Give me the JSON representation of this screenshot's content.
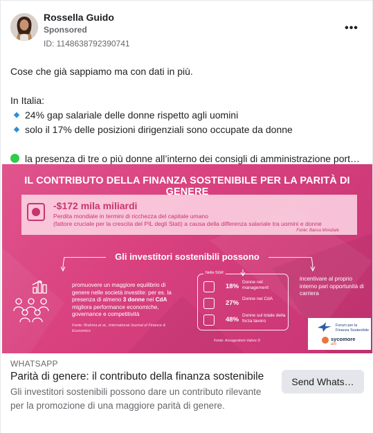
{
  "post": {
    "advertiser_name": "Rossella Guido",
    "sponsored_label": "Sponsored",
    "ad_id": "ID: 1148638792390741",
    "more_icon": "more-horizontal-icon",
    "more_glyph": "•••"
  },
  "body": {
    "intro": "Cose che già sappiamo ma con dati in più.",
    "country_heading": "In Italia:",
    "bullets": [
      "24% gap salariale delle donne rispetto agli uomini",
      "solo il 17% delle posizioni dirigenziali sono occupate da donne"
    ],
    "truncated_line": "la presenza di tre o più donne all’interno dei consigli di amministrazione porta…"
  },
  "banner": {
    "title": "IL CONTRIBUTO DELLA FINANZA SOSTENIBILE PER LA PARITÀ DI GENERE",
    "stat_value": "-$172 mila miliardi",
    "stat_desc_1": "Perdita mondiale in termini di ricchezza del capitale umano",
    "stat_desc_2": "(fattore cruciale per la crescita del PIL degli Stati) a causa della differenza salariale tra uomini e donne",
    "stat_source": "Fonte: Banca Mondiale",
    "section_title": "Gli investitori sostenibili possono",
    "left_text_1": "promuovere un maggiore equilibrio di genere nelle società investite: per es. la presenza di almeno ",
    "left_text_bold_1": "3 donne",
    "left_text_2": " nei ",
    "left_text_bold_2": "CdA",
    "left_text_3": " migliora performance economiche, governance e competitività",
    "left_source": "Fonte: Brahma et al., International Journal of Finance & Economics",
    "sgr_label": "Nelle SGR",
    "sgr_rows": [
      {
        "pct": "18%",
        "text": "Donne nel management"
      },
      {
        "pct": "27%",
        "text": "Donne nei CdA"
      },
      {
        "pct": "48%",
        "text": "Donne sul totale della forza lavoro"
      }
    ],
    "sgr_source": "Fonte: Assogestioni-Valore D",
    "right_text": "incentivare al proprio interno pari opportunità di carriera",
    "logo_forum": "Forum per la Finanza Sostenibile",
    "logo_sycomore": "sycomore",
    "logo_am": "am",
    "colors": {
      "banner_pink": "#d9417f",
      "stat_text": "#c8346f"
    }
  },
  "link_card": {
    "domain": "WHATSAPP",
    "headline": "Parità di genere: il contributo della finanza sostenibile",
    "description": "Gli investitori sostenibili possono dare un contributo rilevante per la promozione di una maggiore parità di genere.",
    "cta_label": "Send Whats…"
  }
}
